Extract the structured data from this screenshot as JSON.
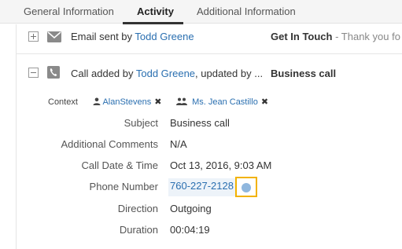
{
  "tabs": [
    {
      "label": "General Information",
      "active": false
    },
    {
      "label": "Activity",
      "active": true
    },
    {
      "label": "Additional Information",
      "active": false
    }
  ],
  "activities": [
    {
      "type_icon": "envelope-icon",
      "expand_icon": "plus-icon",
      "prefix": "Email sent by ",
      "user": "Todd Greene",
      "subject": "Get In Touch",
      "preview": " - Thank you fo"
    },
    {
      "type_icon": "phone-icon",
      "expand_icon": "minus-icon",
      "prefix": "Call added by ",
      "user": "Todd Greene",
      "suffix": ", updated by ...",
      "subject": "Business call",
      "context": {
        "label": "Context",
        "items": [
          {
            "icon": "user-icon",
            "name": "AlanStevens"
          },
          {
            "icon": "group-icon",
            "name": "Ms. Jean Castillo"
          }
        ],
        "remove_icon": "close-icon"
      },
      "details": {
        "subject_label": "Subject",
        "subject_value": "Business call",
        "comments_label": "Additional Comments",
        "comments_value": "N/A",
        "datetime_label": "Call Date & Time",
        "datetime_value": "Oct 13, 2016, 9:03 AM",
        "phone_label": "Phone Number",
        "phone_value": "760-227-2128",
        "direction_label": "Direction",
        "direction_value": "Outgoing",
        "duration_label": "Duration",
        "duration_value": "00:04:19"
      }
    }
  ],
  "colors": {
    "link": "#2a6fb0",
    "highlight_border": "#f2b200",
    "phone_bg": "#edf3f9"
  }
}
